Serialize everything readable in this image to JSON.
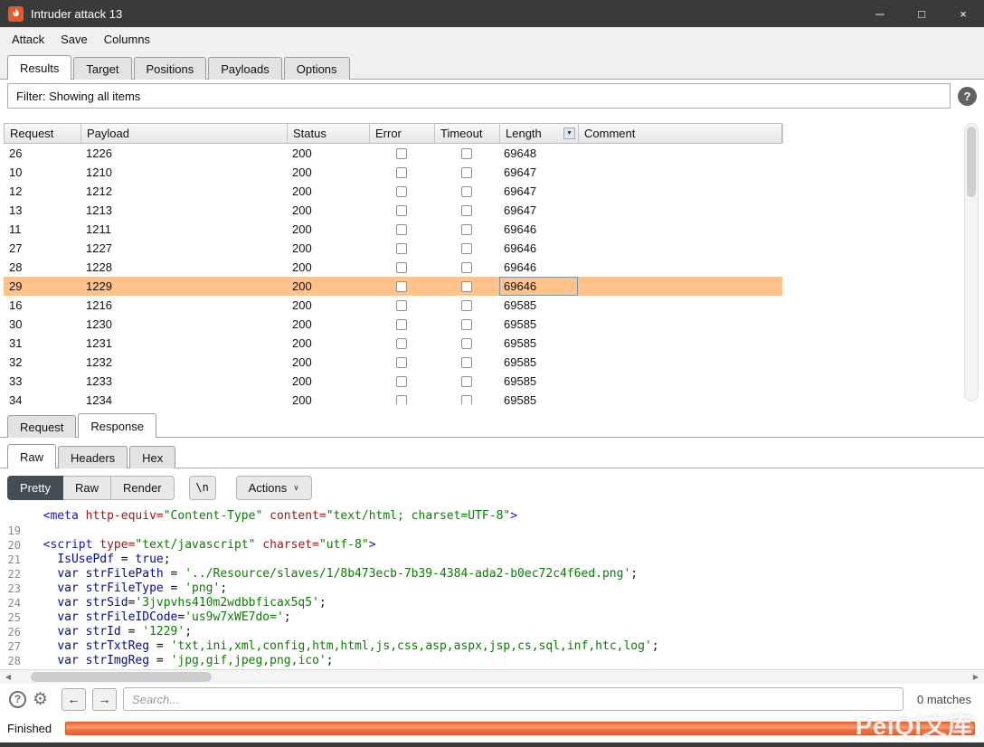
{
  "window": {
    "title": "Intruder attack 13",
    "controls": {
      "minimize": "─",
      "maximize": "□",
      "close": "×"
    }
  },
  "menu": {
    "items": [
      {
        "label": "Attack"
      },
      {
        "label": "Save"
      },
      {
        "label": "Columns"
      }
    ]
  },
  "main_tabs": {
    "items": [
      {
        "label": "Results",
        "selected": true
      },
      {
        "label": "Target"
      },
      {
        "label": "Positions"
      },
      {
        "label": "Payloads"
      },
      {
        "label": "Options"
      }
    ]
  },
  "filter": {
    "text": "Filter: Showing all items",
    "help_glyph": "?"
  },
  "results_table": {
    "columns": [
      {
        "label": "Request"
      },
      {
        "label": "Payload"
      },
      {
        "label": "Status"
      },
      {
        "label": "Error"
      },
      {
        "label": "Timeout"
      },
      {
        "label": "Length",
        "sorted": true,
        "sort_glyph": "▼"
      },
      {
        "label": "Comment"
      }
    ],
    "rows": [
      {
        "request": "26",
        "payload": "1226",
        "status": "200",
        "length": "69648"
      },
      {
        "request": "10",
        "payload": "1210",
        "status": "200",
        "length": "69647"
      },
      {
        "request": "12",
        "payload": "1212",
        "status": "200",
        "length": "69647"
      },
      {
        "request": "13",
        "payload": "1213",
        "status": "200",
        "length": "69647"
      },
      {
        "request": "11",
        "payload": "1211",
        "status": "200",
        "length": "69646"
      },
      {
        "request": "27",
        "payload": "1227",
        "status": "200",
        "length": "69646"
      },
      {
        "request": "28",
        "payload": "1228",
        "status": "200",
        "length": "69646"
      },
      {
        "request": "29",
        "payload": "1229",
        "status": "200",
        "length": "69646",
        "selected": true
      },
      {
        "request": "16",
        "payload": "1216",
        "status": "200",
        "length": "69585"
      },
      {
        "request": "30",
        "payload": "1230",
        "status": "200",
        "length": "69585"
      },
      {
        "request": "31",
        "payload": "1231",
        "status": "200",
        "length": "69585"
      },
      {
        "request": "32",
        "payload": "1232",
        "status": "200",
        "length": "69585"
      },
      {
        "request": "33",
        "payload": "1233",
        "status": "200",
        "length": "69585"
      },
      {
        "request": "34",
        "payload": "1234",
        "status": "200",
        "length": "69585"
      }
    ]
  },
  "message_tabs": {
    "items": [
      {
        "label": "Request"
      },
      {
        "label": "Response",
        "selected": true
      }
    ]
  },
  "view_tabs": {
    "items": [
      {
        "label": "Raw",
        "selected": true
      },
      {
        "label": "Headers"
      },
      {
        "label": "Hex"
      }
    ]
  },
  "editor_toolbar": {
    "modes": [
      {
        "label": "Pretty",
        "selected": true
      },
      {
        "label": "Raw"
      },
      {
        "label": "Render"
      }
    ],
    "newline_button": "\\n",
    "actions_label": "Actions",
    "actions_chevron": "∨"
  },
  "code": {
    "lines": [
      {
        "n": "",
        "segments": [
          [
            "pl",
            "  "
          ],
          [
            "tag",
            "<meta "
          ],
          [
            "attr",
            "http-equiv="
          ],
          [
            "str",
            "\"Content-Type\""
          ],
          [
            "pl",
            " "
          ],
          [
            "attr",
            "content="
          ],
          [
            "str",
            "\"text/html; charset=UTF-8\""
          ],
          [
            "tag",
            ">"
          ]
        ]
      },
      {
        "n": "19",
        "segments": []
      },
      {
        "n": "20",
        "segments": [
          [
            "pl",
            "  "
          ],
          [
            "tag",
            "<script "
          ],
          [
            "attr",
            "type="
          ],
          [
            "str",
            "\"text/javascript\""
          ],
          [
            "pl",
            " "
          ],
          [
            "attr",
            "charset="
          ],
          [
            "str",
            "\"utf-8\""
          ],
          [
            "tag",
            ">"
          ]
        ]
      },
      {
        "n": "21",
        "segments": [
          [
            "pl",
            "    "
          ],
          [
            "kw",
            "IsUsePdf"
          ],
          [
            "pl",
            " = "
          ],
          [
            "kw",
            "true"
          ],
          [
            "pl",
            ";"
          ]
        ]
      },
      {
        "n": "22",
        "segments": [
          [
            "pl",
            "    "
          ],
          [
            "kw",
            "var "
          ],
          [
            "kw",
            "strFilePath"
          ],
          [
            "pl",
            " = "
          ],
          [
            "str",
            "'../Resource/slaves/1/8b473ecb-7b39-4384-ada2-b0ec72c4f6ed.png'"
          ],
          [
            "pl",
            ";"
          ]
        ]
      },
      {
        "n": "23",
        "segments": [
          [
            "pl",
            "    "
          ],
          [
            "kw",
            "var "
          ],
          [
            "kw",
            "strFileType"
          ],
          [
            "pl",
            " = "
          ],
          [
            "str",
            "'png'"
          ],
          [
            "pl",
            ";"
          ]
        ]
      },
      {
        "n": "24",
        "segments": [
          [
            "pl",
            "    "
          ],
          [
            "kw",
            "var "
          ],
          [
            "kw",
            "strSid"
          ],
          [
            "pl",
            "="
          ],
          [
            "str",
            "'3jvpvhs410m2wdbbficax5q5'"
          ],
          [
            "pl",
            ";"
          ]
        ]
      },
      {
        "n": "25",
        "segments": [
          [
            "pl",
            "    "
          ],
          [
            "kw",
            "var "
          ],
          [
            "kw",
            "strFileIDCode"
          ],
          [
            "pl",
            "="
          ],
          [
            "str",
            "'us9w7xWE7do='"
          ],
          [
            "pl",
            ";"
          ]
        ]
      },
      {
        "n": "26",
        "segments": [
          [
            "pl",
            "    "
          ],
          [
            "kw",
            "var "
          ],
          [
            "kw",
            "strId"
          ],
          [
            "pl",
            " = "
          ],
          [
            "str",
            "'1229'"
          ],
          [
            "pl",
            ";"
          ]
        ]
      },
      {
        "n": "27",
        "segments": [
          [
            "pl",
            "    "
          ],
          [
            "kw",
            "var "
          ],
          [
            "kw",
            "strTxtReg"
          ],
          [
            "pl",
            " = "
          ],
          [
            "str",
            "'txt,ini,xml,config,htm,html,js,css,asp,aspx,jsp,cs,sql,inf,htc,log'"
          ],
          [
            "pl",
            ";"
          ]
        ]
      },
      {
        "n": "28",
        "segments": [
          [
            "pl",
            "    "
          ],
          [
            "kw",
            "var "
          ],
          [
            "kw",
            "strImgReg"
          ],
          [
            "pl",
            " = "
          ],
          [
            "str",
            "'jpg,gif,jpeg,png,ico'"
          ],
          [
            "pl",
            ";"
          ]
        ]
      }
    ]
  },
  "search_bar": {
    "placeholder": "Search...",
    "matches": "0 matches",
    "help_glyph": "?",
    "prev_glyph": "←",
    "next_glyph": "→"
  },
  "status_bar": {
    "label": "Finished"
  },
  "watermark": "PeiQi文库",
  "colors": {
    "selection_orange": "#ffc28a",
    "progress_orange": "#ee6b36",
    "titlebar": "#3a3a3a",
    "string_green": "#0a7d00",
    "tag_blue": "#1414c8",
    "attr_red": "#a31515"
  }
}
